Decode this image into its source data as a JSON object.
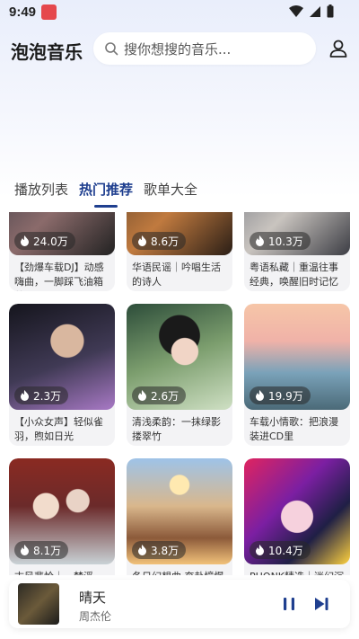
{
  "status": {
    "time": "9:49"
  },
  "header": {
    "title": "泡泡音乐",
    "search_placeholder": "搜你想搜的音乐..."
  },
  "tabs": [
    {
      "label": "播放列表",
      "active": false
    },
    {
      "label": "热门推荐",
      "active": true
    },
    {
      "label": "歌单大全",
      "active": false
    }
  ],
  "playlists": [
    {
      "count": "24.0万",
      "name": "【劲爆车载DJ】动感嗨曲，一脚踩飞油箱盖"
    },
    {
      "count": "8.6万",
      "name": "华语民谣｜吟唱生活的诗人"
    },
    {
      "count": "10.3万",
      "name": "粤语私藏｜重温往事经典，唤醒旧时记忆"
    },
    {
      "count": "2.3万",
      "name": "【小众女声】轻似雀羽，煦如日光"
    },
    {
      "count": "2.6万",
      "name": "清浅柔韵：一抹绿影搂翠竹"
    },
    {
      "count": "19.9万",
      "name": "车载小情歌：把浪漫装进CD里"
    },
    {
      "count": "8.1万",
      "name": "古风悲怆｜一梦浮生，相思寄昭昭"
    },
    {
      "count": "3.8万",
      "name": "冬日幻想曲 奔赴憧憬中的小确幸"
    },
    {
      "count": "10.4万",
      "name": "PHONK精选｜迷幻沉醉，彻底疯狂"
    }
  ],
  "player": {
    "song": "晴天",
    "artist": "周杰伦"
  },
  "colors": {
    "accent": "#1f3f8f",
    "background_top": "#e9eefb"
  }
}
